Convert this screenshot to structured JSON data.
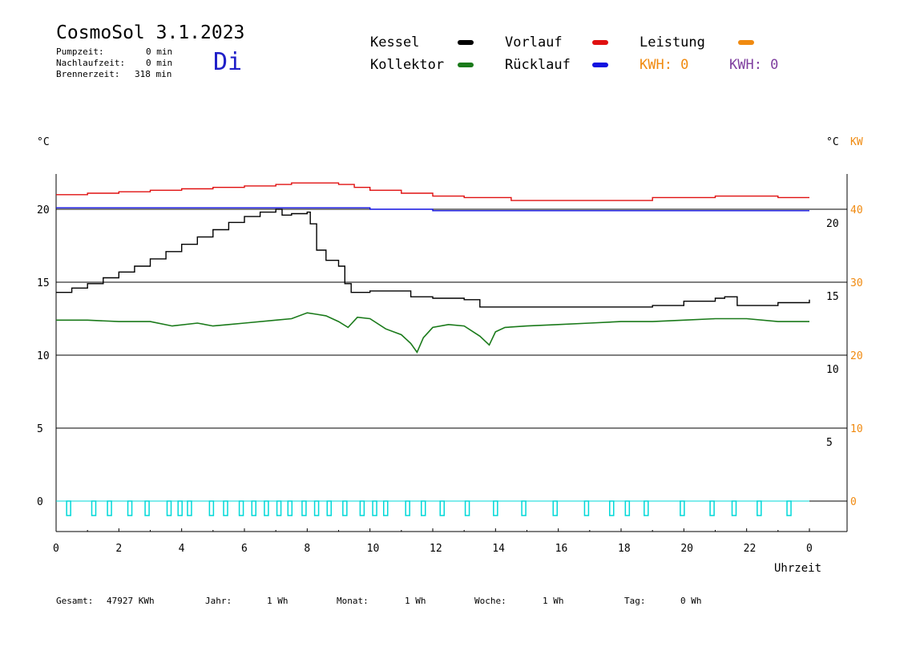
{
  "header": {
    "title": "CosmoSol 3.1.2023",
    "day": "Di",
    "pumpzeit_label": "Pumpzeit:",
    "pumpzeit_value": "0 min",
    "nachlauf_label": "Nachlaufzeit:",
    "nachlauf_value": "0 min",
    "brenner_label": "Brennerzeit:",
    "brenner_value": "318 min"
  },
  "legend": {
    "kessel": "Kessel",
    "kollektor": "Kollektor",
    "vorlauf": "Vorlauf",
    "ruecklauf": "Rücklauf",
    "leistung": "Leistung",
    "kwh_orange": "KWH: 0",
    "kwh_purple": "KWH: 0"
  },
  "colors": {
    "kessel": "#000000",
    "kollektor": "#1a7a1a",
    "vorlauf": "#e01010",
    "ruecklauf": "#1010e0",
    "leistung": "#f08a10",
    "kwh_purple": "#8040a0",
    "pump": "#00d8d8",
    "day": "#2020c8"
  },
  "axes": {
    "left_unit": "°C",
    "right_unit_c": "°C",
    "right_unit_kw": "KW",
    "xlabel": "Uhrzeit"
  },
  "footer": {
    "gesamt_label": "Gesamt:",
    "gesamt_value": "47927 KWh",
    "jahr_label": "Jahr:",
    "jahr_value": "1 Wh",
    "monat_label": "Monat:",
    "monat_value": "1 Wh",
    "woche_label": "Woche:",
    "woche_value": "1 Wh",
    "tag_label": "Tag:",
    "tag_value": "0 Wh"
  },
  "chart_data": {
    "type": "line",
    "xlabel": "Uhrzeit",
    "x_ticks": [
      "0",
      "2",
      "4",
      "6",
      "8",
      "10",
      "12",
      "14",
      "16",
      "18",
      "20",
      "22",
      "0"
    ],
    "y_left_ticks": [
      "0",
      "5",
      "10",
      "15",
      "20"
    ],
    "y_right_ticks": [
      "5",
      "10",
      "15",
      "20"
    ],
    "y_right_kw_ticks": [
      "0",
      "10",
      "20",
      "30",
      "40"
    ],
    "ylim_left": [
      0,
      20
    ],
    "xlim": [
      0,
      24
    ],
    "grid": true,
    "series": [
      {
        "name": "Kessel",
        "color": "#000000",
        "x": [
          0,
          0.5,
          1,
          1.5,
          2,
          2.5,
          3,
          3.5,
          4,
          4.5,
          5,
          5.5,
          6,
          6.5,
          7,
          7.2,
          7.5,
          8,
          8.1,
          8.3,
          8.6,
          9,
          9.2,
          9.4,
          10,
          11,
          11.3,
          12,
          13,
          13.5,
          14,
          15,
          16,
          17,
          18,
          19,
          20,
          21,
          21.3,
          21.7,
          22,
          23,
          24
        ],
        "values": [
          14.3,
          14.6,
          14.9,
          15.3,
          15.7,
          16.1,
          16.6,
          17.1,
          17.6,
          18.1,
          18.6,
          19.1,
          19.5,
          19.8,
          20.0,
          19.6,
          19.7,
          19.8,
          19.0,
          17.2,
          16.5,
          16.1,
          14.9,
          14.3,
          14.4,
          14.4,
          14.0,
          13.9,
          13.8,
          13.3,
          13.3,
          13.3,
          13.3,
          13.3,
          13.3,
          13.4,
          13.7,
          13.9,
          14.0,
          13.4,
          13.4,
          13.6,
          13.8
        ]
      },
      {
        "name": "Kollektor",
        "color": "#1a7a1a",
        "x": [
          0,
          1,
          2,
          3,
          3.7,
          4.5,
          5,
          5.5,
          6,
          7,
          7.5,
          8,
          8.3,
          8.6,
          9,
          9.3,
          9.6,
          10,
          10.5,
          11,
          11.3,
          11.5,
          11.7,
          12,
          12.5,
          13,
          13.5,
          13.8,
          14,
          14.3,
          15,
          16,
          17,
          18,
          19,
          20,
          21,
          22,
          23,
          24
        ],
        "values": [
          12.4,
          12.4,
          12.3,
          12.3,
          12.0,
          12.2,
          12.0,
          12.1,
          12.2,
          12.4,
          12.5,
          12.9,
          12.8,
          12.7,
          12.3,
          11.9,
          12.6,
          12.5,
          11.8,
          11.4,
          10.8,
          10.2,
          11.2,
          11.9,
          12.1,
          12.0,
          11.3,
          10.7,
          11.6,
          11.9,
          12.0,
          12.1,
          12.2,
          12.3,
          12.3,
          12.4,
          12.5,
          12.5,
          12.3,
          12.3
        ]
      },
      {
        "name": "Vorlauf",
        "color": "#e01010",
        "x": [
          0,
          1,
          2,
          3,
          4,
          5,
          6,
          7,
          7.5,
          8,
          8.5,
          9,
          9.5,
          10,
          11,
          12,
          13,
          14,
          14.5,
          15,
          16,
          17,
          18,
          19,
          20,
          21,
          22,
          23,
          24
        ],
        "values": [
          21.0,
          21.1,
          21.2,
          21.3,
          21.4,
          21.5,
          21.6,
          21.7,
          21.8,
          21.8,
          21.8,
          21.7,
          21.5,
          21.3,
          21.1,
          20.9,
          20.8,
          20.8,
          20.6,
          20.6,
          20.6,
          20.6,
          20.6,
          20.8,
          20.8,
          20.9,
          20.9,
          20.8,
          20.8
        ]
      },
      {
        "name": "Rücklauf",
        "color": "#1010e0",
        "x": [
          0,
          2,
          4,
          6,
          8,
          10,
          12,
          14,
          16,
          18,
          20,
          22,
          24
        ],
        "values": [
          20.1,
          20.1,
          20.1,
          20.1,
          20.1,
          20.0,
          19.9,
          19.9,
          19.9,
          19.9,
          19.9,
          19.9,
          19.9
        ]
      }
    ],
    "pump_pulses_hours": [
      0.4,
      1.2,
      1.7,
      2.35,
      2.9,
      3.6,
      3.95,
      4.25,
      4.95,
      5.4,
      5.9,
      6.3,
      6.7,
      7.1,
      7.45,
      7.9,
      8.3,
      8.7,
      9.2,
      9.75,
      10.15,
      10.5,
      11.2,
      11.7,
      12.3,
      13.1,
      14.0,
      14.9,
      15.9,
      16.9,
      17.7,
      18.2,
      18.8,
      19.95,
      20.9,
      21.6,
      22.4,
      23.35
    ]
  }
}
